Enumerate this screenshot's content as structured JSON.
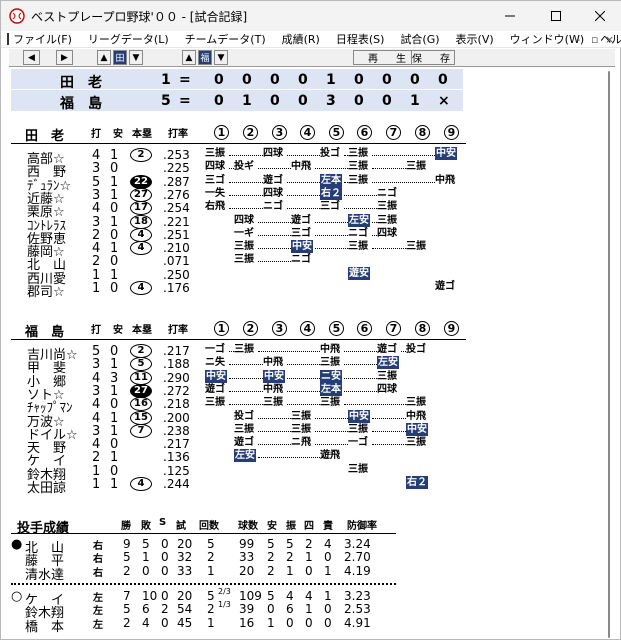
{
  "window": {
    "title": "ベストプレープロ野球'００ - [試合記録]"
  },
  "menu": [
    "ファイル(F)",
    "リーグデータ(L)",
    "チームデータ(T)",
    "成績(R)",
    "日程表(S)",
    "試合(G)",
    "表示(V)",
    "ウィンドウ(W)",
    "ヘルプ(H)"
  ],
  "toolbar": {
    "team1": "田",
    "team2": "福",
    "play": "再　生",
    "save": "保　存"
  },
  "score": {
    "rows": [
      {
        "team": "田　老",
        "total": "1",
        "innings": [
          "0",
          "0",
          "0",
          "0",
          "1",
          "0",
          "0",
          "0",
          "0"
        ]
      },
      {
        "team": "福　島",
        "total": "5",
        "innings": [
          "0",
          "1",
          "0",
          "0",
          "3",
          "0",
          "0",
          "1",
          "×"
        ]
      }
    ]
  },
  "headers": {
    "ab": "打",
    "h": "安",
    "hr": "本塁",
    "avg": "打率",
    "innings": [
      "1",
      "2",
      "3",
      "4",
      "5",
      "6",
      "7",
      "8",
      "9"
    ]
  },
  "batting": [
    {
      "team": "田　老",
      "players": [
        {
          "name": "高部☆",
          "ab": "4",
          "h": "1",
          "hr": "2",
          "hr_on": false,
          "avg": ".253",
          "res": [
            [
              "三振",
              1
            ],
            [
              "四球",
              3
            ],
            [
              "投ゴ",
              5
            ],
            [
              "三振",
              6
            ],
            [
              "中安",
              9,
              1
            ]
          ]
        },
        {
          "name": "西　野",
          "ab": "3",
          "h": "0",
          "hr": "",
          "hr_on": false,
          "avg": ".225",
          "res": [
            [
              "四球",
              1
            ],
            [
              "投ギ",
              2
            ],
            [
              "中飛",
              4
            ],
            [
              "三振",
              6
            ],
            [
              "三振",
              8
            ]
          ]
        },
        {
          "name": "ﾃﾞｭﾗﾝ☆",
          "ab": "5",
          "h": "1",
          "hr": "22",
          "hr_on": true,
          "avg": ".287",
          "res": [
            [
              "三ゴ",
              1
            ],
            [
              "遊ゴ",
              3
            ],
            [
              "左本",
              5,
              1
            ],
            [
              "三振",
              6
            ],
            [
              "中飛",
              9
            ]
          ]
        },
        {
          "name": "近藤☆",
          "ab": "3",
          "h": "1",
          "hr": "27",
          "hr_on": false,
          "avg": ".276",
          "res": [
            [
              "一失",
              1
            ],
            [
              "四球",
              3
            ],
            [
              "右２",
              5,
              1
            ],
            [
              "ニゴ",
              7
            ]
          ]
        },
        {
          "name": "栗原☆",
          "ab": "4",
          "h": "0",
          "hr": "17",
          "hr_on": false,
          "avg": ".254",
          "res": [
            [
              "右飛",
              1
            ],
            [
              "ニゴ",
              3
            ],
            [
              "三ゴ",
              5
            ],
            [
              "三振",
              7
            ]
          ]
        },
        {
          "name": "ｺﾝﾄﾚﾗｽ",
          "ab": "3",
          "h": "1",
          "hr": "18",
          "hr_on": false,
          "avg": ".221",
          "res": [
            [
              "四球",
              2
            ],
            [
              "遊ゴ",
              4
            ],
            [
              "左安",
              6,
              1
            ],
            [
              "三振",
              7
            ]
          ]
        },
        {
          "name": "佐野恵",
          "ab": "2",
          "h": "0",
          "hr": "4",
          "hr_on": false,
          "avg": ".251",
          "res": [
            [
              "一ギ",
              2
            ],
            [
              "三ゴ",
              4
            ],
            [
              "ニゴ",
              6
            ],
            [
              "四球",
              7
            ]
          ]
        },
        {
          "name": "藤岡☆",
          "ab": "4",
          "h": "1",
          "hr": "4",
          "hr_on": false,
          "avg": ".210",
          "res": [
            [
              "三振",
              2
            ],
            [
              "中安",
              4,
              1
            ],
            [
              "三振",
              6
            ],
            [
              "三振",
              8
            ]
          ]
        },
        {
          "name": "北　山",
          "ab": "2",
          "h": "0",
          "hr": "",
          "hr_on": false,
          "avg": ".071",
          "res": [
            [
              "三振",
              2
            ],
            [
              "ニゴ",
              4
            ]
          ]
        },
        {
          "name": "西川愛",
          "ab": "1",
          "h": "1",
          "hr": "",
          "hr_on": false,
          "avg": ".250",
          "res": [
            [
              "遊安",
              6,
              1
            ]
          ]
        },
        {
          "name": "郡司☆",
          "ab": "1",
          "h": "0",
          "hr": "4",
          "hr_on": false,
          "avg": ".176",
          "res": [
            [
              "遊ゴ",
              9
            ]
          ]
        }
      ]
    },
    {
      "team": "福　島",
      "players": [
        {
          "name": "吉川尚☆",
          "ab": "5",
          "h": "0",
          "hr": "2",
          "hr_on": false,
          "avg": ".217",
          "res": [
            [
              "一ゴ",
              1
            ],
            [
              "三振",
              2
            ],
            [
              "中飛",
              5
            ],
            [
              "遊ゴ",
              7
            ],
            [
              "投ゴ",
              8
            ]
          ]
        },
        {
          "name": "甲　斐",
          "ab": "3",
          "h": "1",
          "hr": "5",
          "hr_on": false,
          "avg": ".188",
          "res": [
            [
              "ニ失",
              1
            ],
            [
              "中飛",
              3
            ],
            [
              "三振",
              5
            ],
            [
              "左安",
              7,
              1
            ]
          ]
        },
        {
          "name": "小　郷",
          "ab": "4",
          "h": "3",
          "hr": "11",
          "hr_on": false,
          "avg": ".290",
          "res": [
            [
              "中安",
              1,
              1
            ],
            [
              "中安",
              3,
              1
            ],
            [
              "ニ安",
              5,
              1
            ],
            [
              "三振",
              7
            ]
          ]
        },
        {
          "name": "ソト☆",
          "ab": "3",
          "h": "1",
          "hr": "27",
          "hr_on": true,
          "avg": ".272",
          "res": [
            [
              "遊ゴ",
              1
            ],
            [
              "中飛",
              3
            ],
            [
              "左本",
              5,
              1
            ],
            [
              "四球",
              7
            ]
          ]
        },
        {
          "name": "ﾁｬｯﾌﾟﾏﾝ",
          "ab": "4",
          "h": "0",
          "hr": "16",
          "hr_on": false,
          "avg": ".218",
          "res": [
            [
              "三振",
              1
            ],
            [
              "三振",
              3
            ],
            [
              "三振",
              5
            ],
            [
              "三振",
              8
            ]
          ]
        },
        {
          "name": "万波☆",
          "ab": "4",
          "h": "1",
          "hr": "15",
          "hr_on": false,
          "avg": ".200",
          "res": [
            [
              "投ゴ",
              2
            ],
            [
              "三振",
              4
            ],
            [
              "中安",
              6,
              1
            ],
            [
              "中飛",
              8
            ]
          ]
        },
        {
          "name": "ドイル☆",
          "ab": "3",
          "h": "1",
          "hr": "7",
          "hr_on": false,
          "avg": ".238",
          "res": [
            [
              "三振",
              2
            ],
            [
              "三振",
              4
            ],
            [
              "三振",
              6
            ],
            [
              "中安",
              8,
              1
            ]
          ]
        },
        {
          "name": "天　野",
          "ab": "4",
          "h": "0",
          "hr": "",
          "hr_on": false,
          "avg": ".217",
          "res": [
            [
              "遊ゴ",
              2
            ],
            [
              "ニ飛",
              4
            ],
            [
              "一ゴ",
              6
            ],
            [
              "三振",
              8
            ]
          ]
        },
        {
          "name": "ケ　イ",
          "ab": "2",
          "h": "1",
          "hr": "",
          "hr_on": false,
          "avg": ".136",
          "res": [
            [
              "左安",
              2,
              1
            ],
            [
              "遊飛",
              5
            ]
          ]
        },
        {
          "name": "鈴木翔",
          "ab": "1",
          "h": "0",
          "hr": "",
          "hr_on": false,
          "avg": ".125",
          "res": [
            [
              "三振",
              6
            ]
          ]
        },
        {
          "name": "太田諒",
          "ab": "1",
          "h": "1",
          "hr": "4",
          "hr_on": false,
          "avg": ".244",
          "res": [
            [
              "右２",
              8,
              1
            ]
          ]
        }
      ]
    }
  ],
  "pitching": {
    "title": "投手成績",
    "headers": [
      "勝",
      "敗",
      "S",
      "試",
      "回数",
      "球数",
      "安",
      "振",
      "四",
      "責",
      "防御率"
    ],
    "groups": [
      {
        "marker": "●",
        "rows": [
          {
            "name": "北　山",
            "hand": "右",
            "w": "9",
            "l": "5",
            "s": "0",
            "g": "20",
            "ip": "5",
            "ip_frac": "",
            "np": "99",
            "h": "5",
            "k": "5",
            "bb": "2",
            "er": "4",
            "era": "3.24"
          },
          {
            "name": "藤　平",
            "hand": "右",
            "w": "5",
            "l": "1",
            "s": "0",
            "g": "32",
            "ip": "2",
            "ip_frac": "",
            "np": "33",
            "h": "2",
            "k": "2",
            "bb": "1",
            "er": "0",
            "era": "2.70"
          },
          {
            "name": "清水達",
            "hand": "右",
            "w": "2",
            "l": "0",
            "s": "0",
            "g": "33",
            "ip": "1",
            "ip_frac": "",
            "np": "20",
            "h": "2",
            "k": "1",
            "bb": "0",
            "er": "1",
            "era": "4.19"
          }
        ]
      },
      {
        "marker": "○",
        "rows": [
          {
            "name": "ケ　イ",
            "hand": "左",
            "w": "7",
            "l": "10",
            "s": "0",
            "g": "20",
            "ip": "5",
            "ip_frac": "2/3",
            "np": "109",
            "h": "5",
            "k": "4",
            "bb": "4",
            "er": "1",
            "era": "3.23"
          },
          {
            "name": "鈴木翔",
            "hand": "左",
            "w": "5",
            "l": "6",
            "s": "2",
            "g": "54",
            "ip": "2",
            "ip_frac": "1/3",
            "np": "39",
            "h": "0",
            "k": "6",
            "bb": "1",
            "er": "0",
            "era": "2.53"
          },
          {
            "name": "橋　本",
            "hand": "左",
            "w": "2",
            "l": "4",
            "s": "0",
            "g": "45",
            "ip": "1",
            "ip_frac": "",
            "np": "16",
            "h": "1",
            "k": "0",
            "bb": "0",
            "er": "0",
            "era": "4.91"
          }
        ]
      }
    ]
  }
}
